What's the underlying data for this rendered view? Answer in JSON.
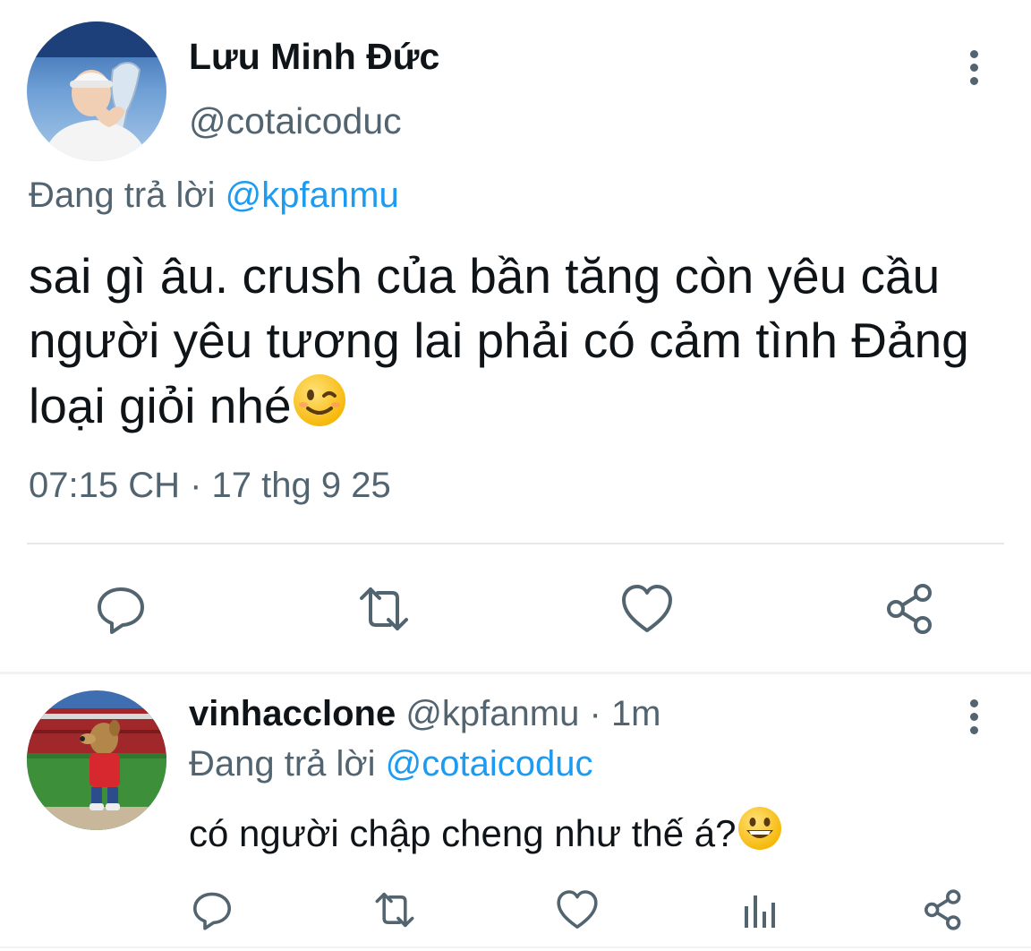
{
  "main_tweet": {
    "author_name": "Lưu Minh Đức",
    "author_handle": "@cotaicoduc",
    "replying_to_prefix": "Đang trả lời",
    "replying_to_handle": "@kpfanmu",
    "text": "sai gì âu. crush của bần tăng còn yêu cầu người yêu tương lai phải có cảm tình Đảng loại giỏi nhé",
    "text_emoji": "winking-face",
    "timestamp": "07:15 CH · 17 thg 9 25",
    "actions": [
      "reply-icon",
      "retweet-icon",
      "like-icon",
      "share-icon"
    ]
  },
  "reply_tweet": {
    "author_name": "vinhacclone",
    "author_handle": "@kpfanmu",
    "separator": "·",
    "time_ago": "1m",
    "replying_to_prefix": "Đang trả lời",
    "replying_to_handle": "@cotaicoduc",
    "text": "có người chập cheng như thế á?",
    "text_emoji": "grinning-face",
    "actions": [
      "reply-icon",
      "retweet-icon",
      "like-icon",
      "views-icon",
      "share-icon"
    ]
  },
  "colors": {
    "text_primary": "#0f1419",
    "text_secondary": "#536471",
    "accent": "#1d9bf0",
    "divider": "#e6e9ec"
  }
}
